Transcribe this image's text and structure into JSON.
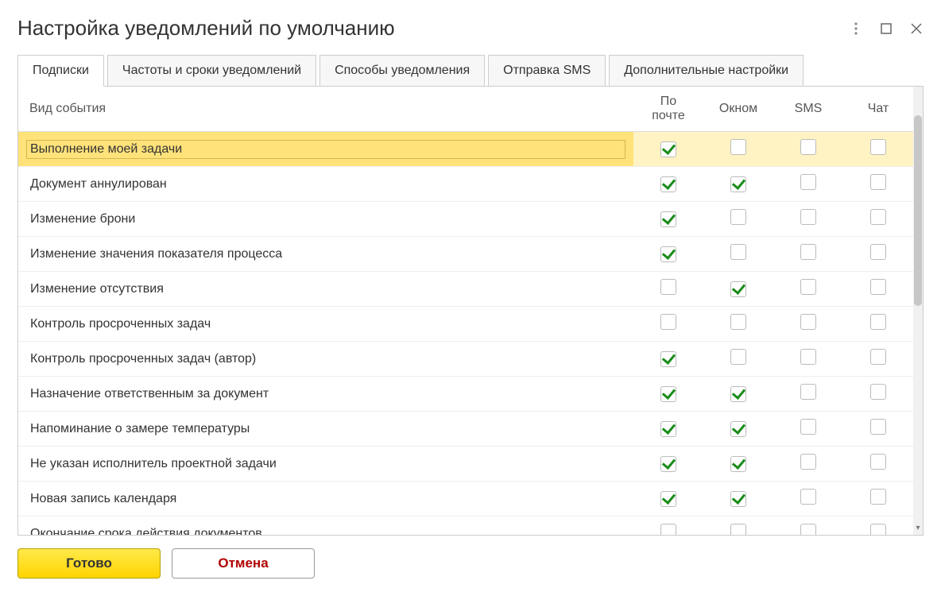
{
  "window": {
    "title": "Настройка уведомлений по умолчанию"
  },
  "tabs": [
    {
      "label": "Подписки",
      "active": true
    },
    {
      "label": "Частоты и сроки уведомлений",
      "active": false
    },
    {
      "label": "Способы уведомления",
      "active": false
    },
    {
      "label": "Отправка SMS",
      "active": false
    },
    {
      "label": "Дополнительные настройки",
      "active": false
    }
  ],
  "table": {
    "headers": {
      "event": "Вид события",
      "email": "По почте",
      "window": "Окном",
      "sms": "SMS",
      "chat": "Чат"
    },
    "rows": [
      {
        "event": "Выполнение моей задачи",
        "email": true,
        "window": false,
        "sms": false,
        "chat": false,
        "selected": true
      },
      {
        "event": "Документ аннулирован",
        "email": true,
        "window": true,
        "sms": false,
        "chat": false
      },
      {
        "event": "Изменение брони",
        "email": true,
        "window": false,
        "sms": false,
        "chat": false
      },
      {
        "event": "Изменение значения показателя процесса",
        "email": true,
        "window": false,
        "sms": false,
        "chat": false
      },
      {
        "event": "Изменение отсутствия",
        "email": false,
        "window": true,
        "sms": false,
        "chat": false
      },
      {
        "event": "Контроль просроченных задач",
        "email": false,
        "window": false,
        "sms": false,
        "chat": false
      },
      {
        "event": "Контроль просроченных задач (автор)",
        "email": true,
        "window": false,
        "sms": false,
        "chat": false
      },
      {
        "event": "Назначение ответственным за документ",
        "email": true,
        "window": true,
        "sms": false,
        "chat": false
      },
      {
        "event": "Напоминание о замере температуры",
        "email": true,
        "window": true,
        "sms": false,
        "chat": false
      },
      {
        "event": "Не указан исполнитель проектной задачи",
        "email": true,
        "window": true,
        "sms": false,
        "chat": false
      },
      {
        "event": "Новая запись календаря",
        "email": true,
        "window": true,
        "sms": false,
        "chat": false
      },
      {
        "event": "Окончание срока действия документов",
        "email": false,
        "window": false,
        "sms": false,
        "chat": false
      }
    ]
  },
  "footer": {
    "ok": "Готово",
    "cancel": "Отмена"
  }
}
